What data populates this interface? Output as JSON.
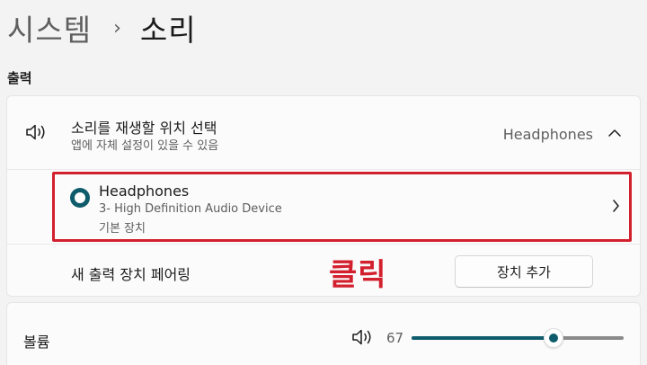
{
  "breadcrumb": {
    "parent": "시스템",
    "separator": "›",
    "current": "소리"
  },
  "output_section": {
    "title": "출력",
    "choose": {
      "icon": "speaker-icon",
      "title": "소리를 재생할 위치 선택",
      "subtitle": "앱에 자체 설정이 있을 수 있음",
      "current_value": "Headphones"
    },
    "device": {
      "name": "Headphones",
      "description": "3- High Definition Audio Device",
      "status": "기본 장치",
      "selected": true
    },
    "pair": {
      "label": "새 출력 장치 페어링",
      "button_label": "장치 추가"
    }
  },
  "annotation": {
    "text": "클릭",
    "color": "#d3202e"
  },
  "volume": {
    "label": "볼륨",
    "icon": "speaker-icon",
    "value": "67",
    "level": 0.67
  },
  "colors": {
    "accent": "#0e5c6b",
    "highlight": "#d3202e"
  }
}
